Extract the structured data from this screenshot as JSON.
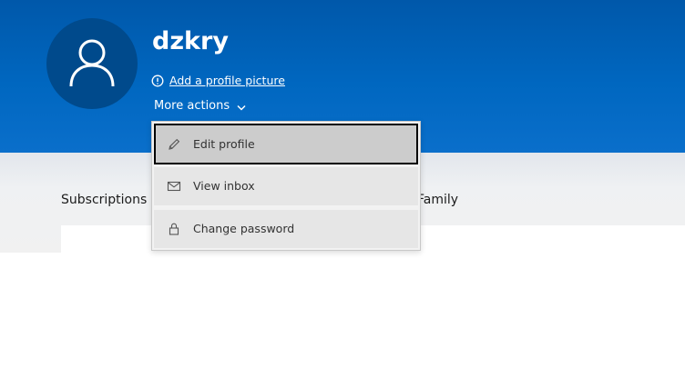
{
  "profile": {
    "name": "dzkry",
    "add_picture_label": "Add a profile picture",
    "more_actions_label": "More actions"
  },
  "tabs": [
    {
      "label": "Subscriptions"
    },
    {
      "label": "Family"
    }
  ],
  "menu": {
    "items": [
      {
        "label": "Edit profile",
        "icon": "pencil-icon",
        "selected": true
      },
      {
        "label": "View inbox",
        "icon": "mail-icon",
        "selected": false
      },
      {
        "label": "Change password",
        "icon": "lock-icon",
        "selected": false
      }
    ]
  },
  "colors": {
    "header_blue": "#0067c0",
    "avatar_bg": "#004a8c",
    "menu_bg": "#e6e6e6",
    "menu_selected_bg": "#cccccc"
  }
}
